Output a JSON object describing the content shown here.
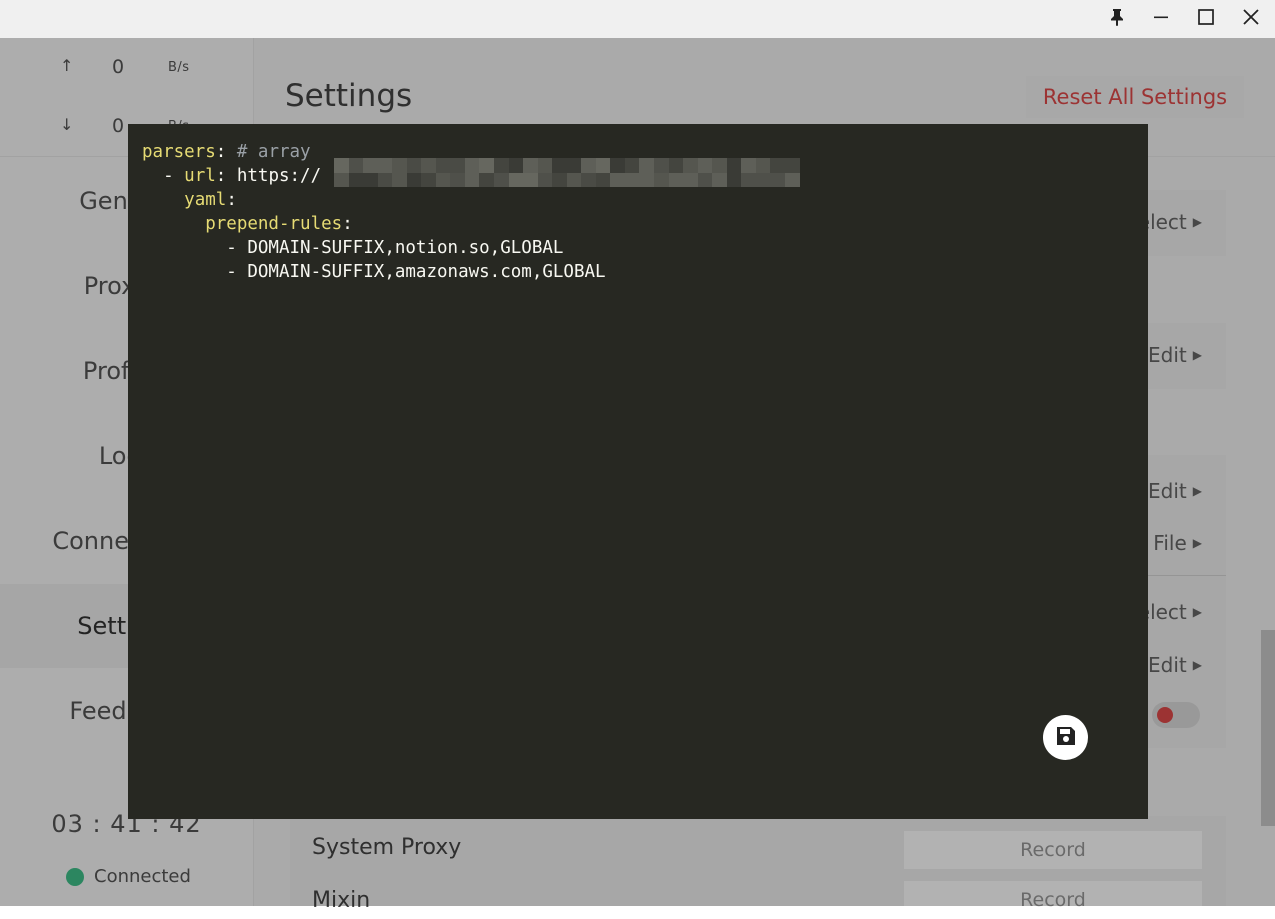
{
  "window": {
    "pin_icon": "pin-icon",
    "minimize_icon": "minimize-icon",
    "maximize_icon": "maximize-icon",
    "close_icon": "close-icon"
  },
  "traffic": {
    "upload": {
      "arrow": "↑",
      "value": "0",
      "unit": "B/s"
    },
    "download": {
      "arrow": "↓",
      "value": "0",
      "unit": "B/s"
    }
  },
  "sidebar": {
    "items": [
      {
        "label": "General"
      },
      {
        "label": "Proxies"
      },
      {
        "label": "Profiles"
      },
      {
        "label": "Logs"
      },
      {
        "label": "Connections"
      },
      {
        "label": "Settings",
        "active": true
      },
      {
        "label": "Feedback"
      }
    ],
    "timer": "03 : 41 : 42",
    "status": "Connected",
    "status_color": "#3fc18a"
  },
  "main": {
    "title": "Settings",
    "reset_label": "Reset All Settings",
    "reset_color": "#e04a4a",
    "actions": {
      "select1": "Select",
      "edit1": "Edit",
      "edit2": "Edit",
      "file": "File",
      "select2": "Select",
      "edit3": "Edit"
    },
    "rows": [
      {
        "label": "System Proxy",
        "button": "Record"
      },
      {
        "label": "Mixin",
        "button": "Record"
      }
    ]
  },
  "editor": {
    "lines": {
      "l1_key": "parsers",
      "l1_colon": ": ",
      "l1_comment": "# array",
      "l2_prefix": "  - ",
      "l2_key": "url",
      "l2_colon": ": ",
      "l2_value": "https://",
      "l3_prefix": "    ",
      "l3_key": "yaml",
      "l3_colon": ":",
      "l4_prefix": "      ",
      "l4_key": "prepend-rules",
      "l4_colon": ":",
      "l5": "        - DOMAIN-SUFFIX,notion.so,GLOBAL",
      "l6": "        - DOMAIN-SUFFIX,amazonaws.com,GLOBAL"
    },
    "save_icon": "save-icon"
  }
}
